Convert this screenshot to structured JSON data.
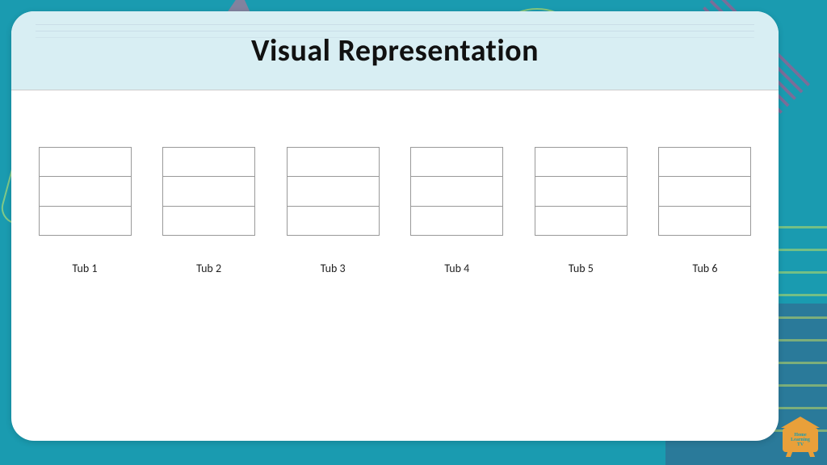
{
  "header": {
    "title": "Visual Representation"
  },
  "tubs": [
    {
      "label": "Tub 1"
    },
    {
      "label": "Tub 2"
    },
    {
      "label": "Tub 3"
    },
    {
      "label": "Tub 4"
    },
    {
      "label": "Tub 5"
    },
    {
      "label": "Tub 6"
    }
  ],
  "logo": {
    "line1": "Home",
    "line2": "Learning",
    "line3": "TV"
  }
}
